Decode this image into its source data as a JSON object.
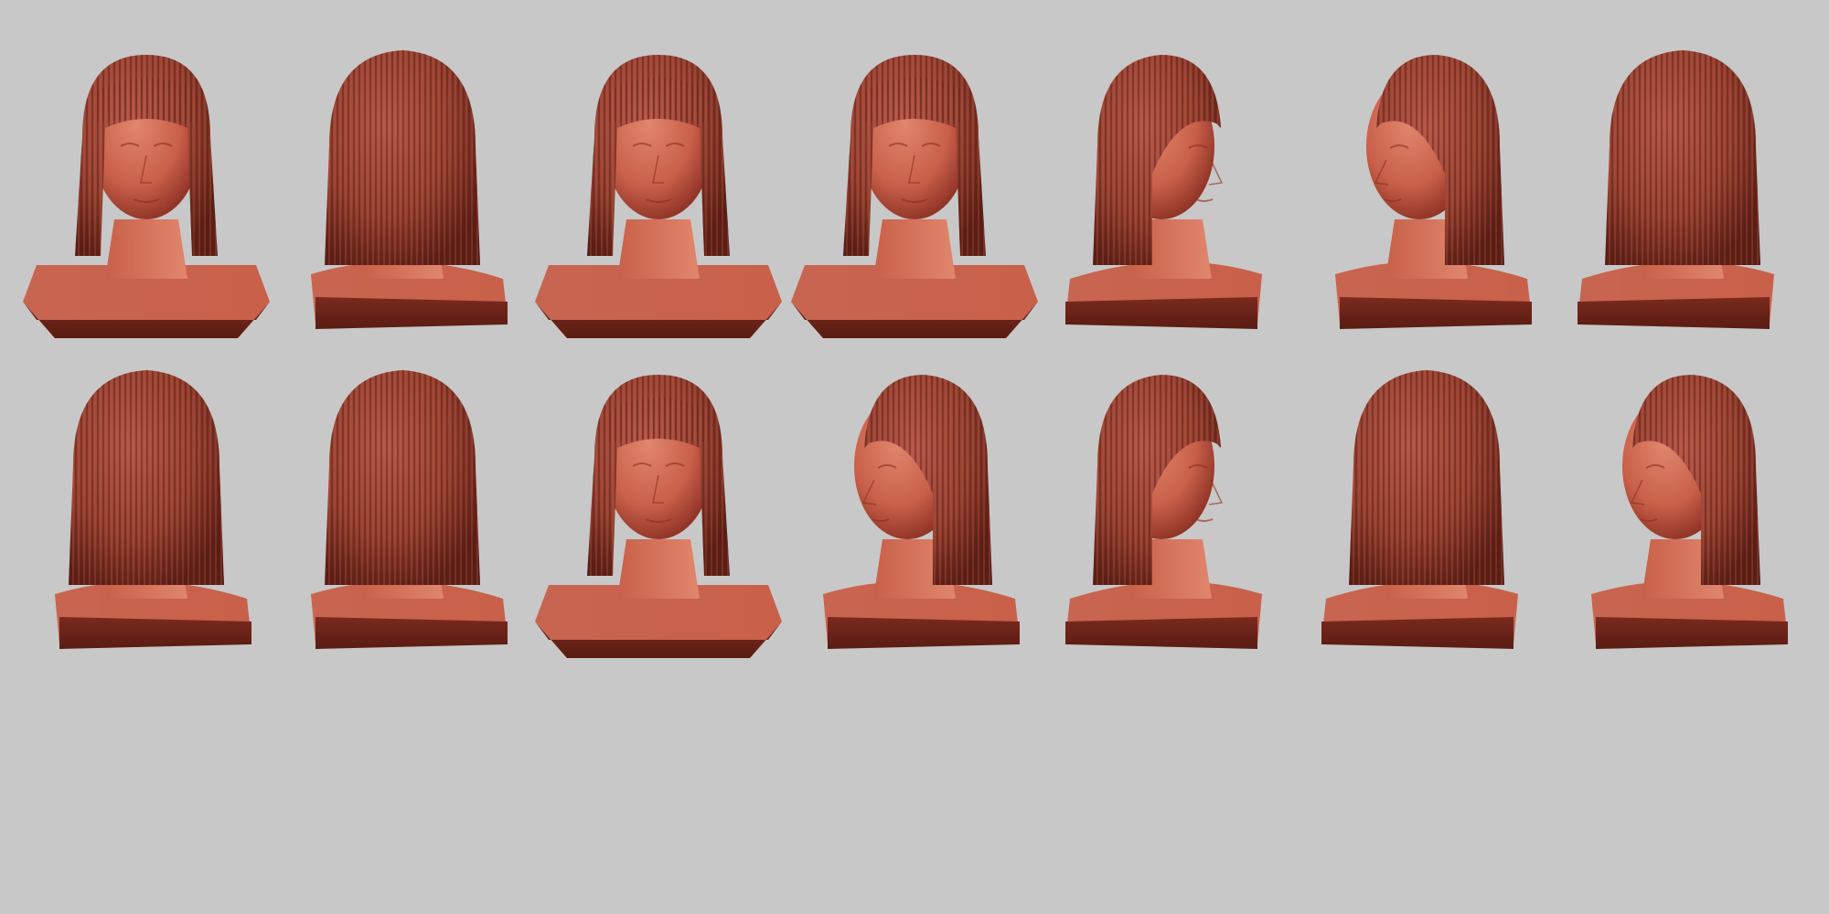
{
  "scene": {
    "background_color": "#c8c8c8",
    "material": {
      "skin_light": "#e0866c",
      "skin_mid": "#c9604a",
      "skin_dark": "#8a2f22",
      "hair_light": "#b8584a",
      "hair_mid": "#95402f",
      "hair_dark": "#5a1d14",
      "base_front": "#7a2a1e",
      "base_top": "#c86550"
    },
    "rows": [
      {
        "views": [
          {
            "name": "view-front-3q-left",
            "angle": "front",
            "tilt": -1
          },
          {
            "name": "view-back-3q-right",
            "angle": "back-right",
            "tilt": 1
          },
          {
            "name": "view-front-center",
            "angle": "front",
            "tilt": 0
          },
          {
            "name": "view-front-center-2",
            "angle": "front",
            "tilt": 0
          },
          {
            "name": "view-profile-right",
            "angle": "right",
            "tilt": 0
          },
          {
            "name": "view-3q-left",
            "angle": "left-3q",
            "tilt": 0
          },
          {
            "name": "view-back-3q-left",
            "angle": "back-left",
            "tilt": 0
          }
        ]
      },
      {
        "views": [
          {
            "name": "view-back-3q-right-low",
            "angle": "back-right",
            "tilt": 0
          },
          {
            "name": "view-back-center",
            "angle": "back",
            "tilt": 0
          },
          {
            "name": "view-front-center-low",
            "angle": "front",
            "tilt": 0
          },
          {
            "name": "view-front-down-left",
            "angle": "left-3q",
            "tilt": 1
          },
          {
            "name": "view-profile-right-low",
            "angle": "right",
            "tilt": 0
          },
          {
            "name": "view-back-3q-low",
            "angle": "back-left",
            "tilt": 0
          },
          {
            "name": "view-3q-left-low",
            "angle": "left-3q",
            "tilt": 0
          }
        ]
      }
    ]
  }
}
